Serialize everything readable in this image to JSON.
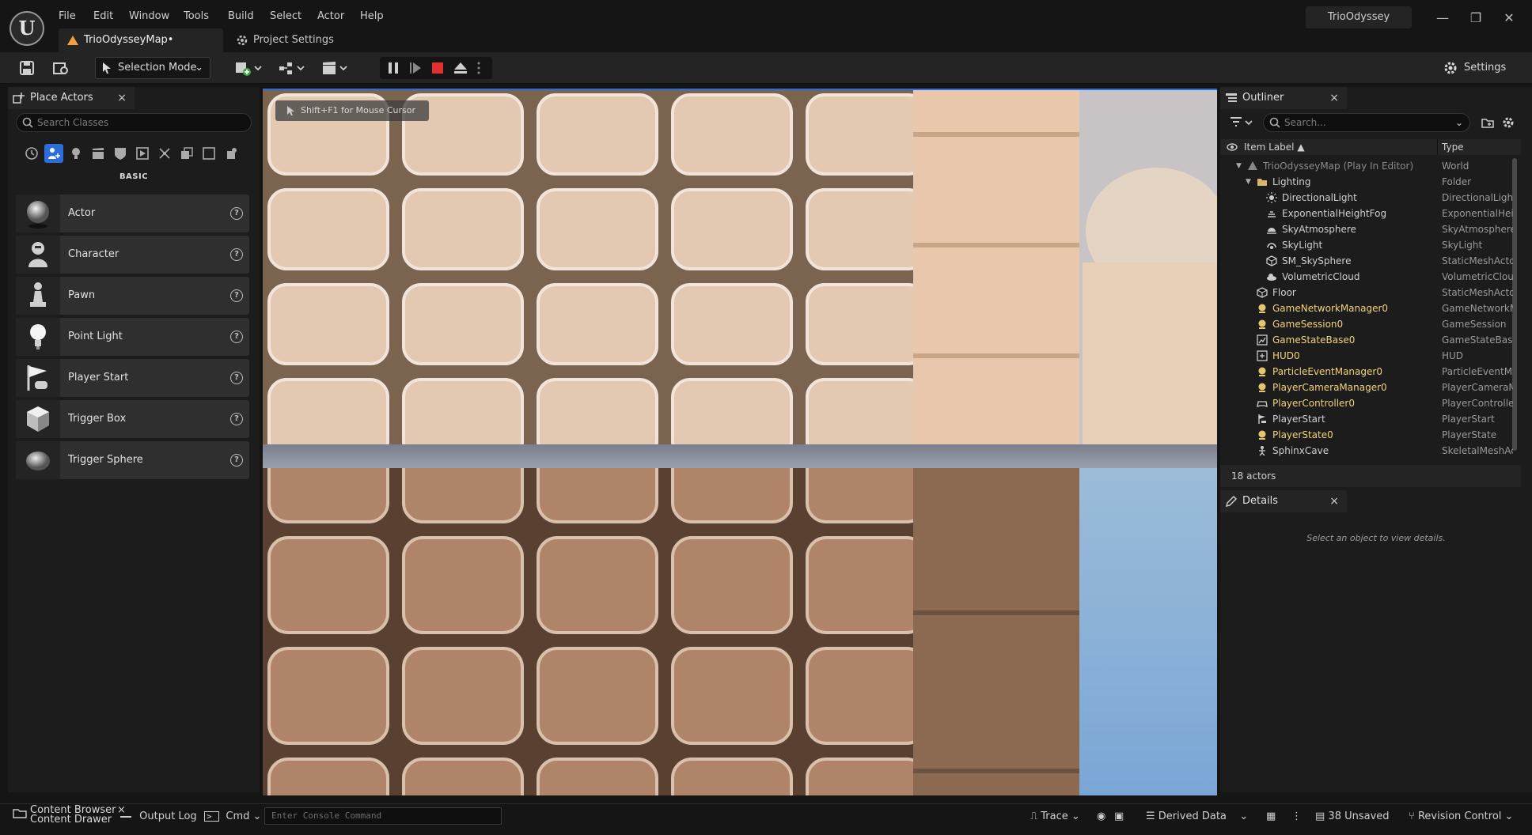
{
  "app": {
    "project_name": "TrioOdyssey",
    "menu": [
      "File",
      "Edit",
      "Window",
      "Tools",
      "Build",
      "Select",
      "Actor",
      "Help"
    ],
    "tabs": [
      {
        "label": "TrioOdysseyMap•"
      },
      {
        "label": "Project Settings"
      }
    ],
    "window_controls": {
      "minimize": "—",
      "restore": "❐",
      "close": "✕"
    }
  },
  "toolbar": {
    "selection_mode": "Selection Mode",
    "settings": "Settings"
  },
  "place_actors": {
    "tab_label": "Place Actors",
    "close": "×",
    "search_placeholder": "Search Classes",
    "category": "BASIC",
    "items": [
      {
        "label": "Actor",
        "icon": "sphere-icon"
      },
      {
        "label": "Character",
        "icon": "character-icon"
      },
      {
        "label": "Pawn",
        "icon": "pawn-icon"
      },
      {
        "label": "Point Light",
        "icon": "lightbulb-icon"
      },
      {
        "label": "Player Start",
        "icon": "flag-icon"
      },
      {
        "label": "Trigger Box",
        "icon": "cube-icon"
      },
      {
        "label": "Trigger Sphere",
        "icon": "sphere-icon"
      }
    ]
  },
  "viewport": {
    "hint": "Shift+F1 for Mouse Cursor"
  },
  "outliner": {
    "tab_label": "Outliner",
    "close": "×",
    "search_placeholder": "Search...",
    "col_label": "Item Label ▲",
    "col_type": "Type",
    "rows": [
      {
        "label": "TrioOdysseyMap (Play In Editor)",
        "type": "World",
        "depth": 0,
        "color": "#8a8a8a",
        "icon": "world-icon",
        "arrow": "▼"
      },
      {
        "label": "Lighting",
        "type": "Folder",
        "depth": 1,
        "color": "#d0d0d0",
        "icon": "folder-icon",
        "arrow": "▼"
      },
      {
        "label": "DirectionalLight",
        "type": "DirectionalLight",
        "depth": 2,
        "color": "#d0d0d0",
        "icon": "sun-icon"
      },
      {
        "label": "ExponentialHeightFog",
        "type": "ExponentialHeig",
        "depth": 2,
        "color": "#d0d0d0",
        "icon": "fog-icon"
      },
      {
        "label": "SkyAtmosphere",
        "type": "SkyAtmosphere",
        "depth": 2,
        "color": "#d0d0d0",
        "icon": "atmosphere-icon"
      },
      {
        "label": "SkyLight",
        "type": "SkyLight",
        "depth": 2,
        "color": "#d0d0d0",
        "icon": "skylight-icon"
      },
      {
        "label": "SM_SkySphere",
        "type": "StaticMeshActo",
        "depth": 2,
        "color": "#d0d0d0",
        "icon": "mesh-icon"
      },
      {
        "label": "VolumetricCloud",
        "type": "VolumetricClou",
        "depth": 2,
        "color": "#d0d0d0",
        "icon": "cloud-icon"
      },
      {
        "label": "Floor",
        "type": "StaticMeshActo",
        "depth": 1,
        "color": "#d0d0d0",
        "icon": "mesh-icon"
      },
      {
        "label": "GameNetworkManager0",
        "type": "GameNetworkM",
        "depth": 1,
        "color": "#f2d27a",
        "icon": "actor-icon"
      },
      {
        "label": "GameSession0",
        "type": "GameSession",
        "depth": 1,
        "color": "#f2d27a",
        "icon": "actor-icon"
      },
      {
        "label": "GameStateBase0",
        "type": "GameStateBase",
        "depth": 1,
        "color": "#f2d27a",
        "icon": "gamestate-icon"
      },
      {
        "label": "HUD0",
        "type": "HUD",
        "depth": 1,
        "color": "#f2d27a",
        "icon": "hud-icon"
      },
      {
        "label": "ParticleEventManager0",
        "type": "ParticleEventMa",
        "depth": 1,
        "color": "#f2d27a",
        "icon": "actor-icon"
      },
      {
        "label": "PlayerCameraManager0",
        "type": "PlayerCameraM",
        "depth": 1,
        "color": "#f2d27a",
        "icon": "actor-icon"
      },
      {
        "label": "PlayerController0",
        "type": "PlayerControlle",
        "depth": 1,
        "color": "#f2d27a",
        "icon": "gamepad-icon"
      },
      {
        "label": "PlayerStart",
        "type": "PlayerStart",
        "depth": 1,
        "color": "#d0d0d0",
        "icon": "flag-icon"
      },
      {
        "label": "PlayerState0",
        "type": "PlayerState",
        "depth": 1,
        "color": "#f2d27a",
        "icon": "actor-icon"
      },
      {
        "label": "SphinxCave",
        "type": "SkeletalMeshAc",
        "depth": 1,
        "color": "#d0d0d0",
        "icon": "skeleton-icon"
      }
    ],
    "actors_count": "18 actors"
  },
  "details": {
    "tab_label": "Details",
    "close": "×",
    "empty_text": "Select an object to view details."
  },
  "statusbar": {
    "content_browser": "Content Browser",
    "content_drawer": "Content Drawer",
    "close": "×",
    "output_log": "Output Log",
    "cmd": "Cmd",
    "console_placeholder": "Enter Console Command",
    "trace": "Trace",
    "derived_data": "Derived Data",
    "unsaved": "38 Unsaved",
    "revision_control": "Revision Control"
  }
}
